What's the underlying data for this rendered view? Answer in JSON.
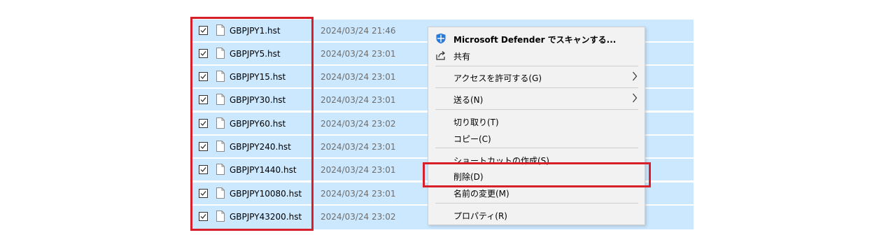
{
  "files": [
    {
      "name": "GBPJPY1.hst",
      "date": "2024/03/24 21:46"
    },
    {
      "name": "GBPJPY5.hst",
      "date": "2024/03/24 23:01"
    },
    {
      "name": "GBPJPY15.hst",
      "date": "2024/03/24 23:01"
    },
    {
      "name": "GBPJPY30.hst",
      "date": "2024/03/24 23:01"
    },
    {
      "name": "GBPJPY60.hst",
      "date": "2024/03/24 23:02"
    },
    {
      "name": "GBPJPY240.hst",
      "date": "2024/03/24 23:01"
    },
    {
      "name": "GBPJPY1440.hst",
      "date": "2024/03/24 23:01"
    },
    {
      "name": "GBPJPY10080.hst",
      "date": "2024/03/24 23:01"
    },
    {
      "name": "GBPJPY43200.hst",
      "date": "2024/03/24 23:02"
    }
  ],
  "context_menu": {
    "defender": "Microsoft Defender でスキャンする...",
    "share": "共有",
    "give_access": "アクセスを許可する(G)",
    "send_to": "送る(N)",
    "cut": "切り取り(T)",
    "copy": "コピー(C)",
    "shortcut": "ショートカットの作成(S)",
    "delete": "削除(D)",
    "rename": "名前の変更(M)",
    "properties": "プロパティ(R)"
  },
  "colors": {
    "selection": "#cce8ff",
    "highlight": "#d7202a",
    "menu_bg": "#f2f2f2",
    "date_text": "#6d6d6d"
  },
  "icons": {
    "defender": "shield-icon",
    "share": "share-icon",
    "submenu": "chevron-right-icon",
    "checkbox": "checkmark-icon",
    "file": "document-icon"
  }
}
